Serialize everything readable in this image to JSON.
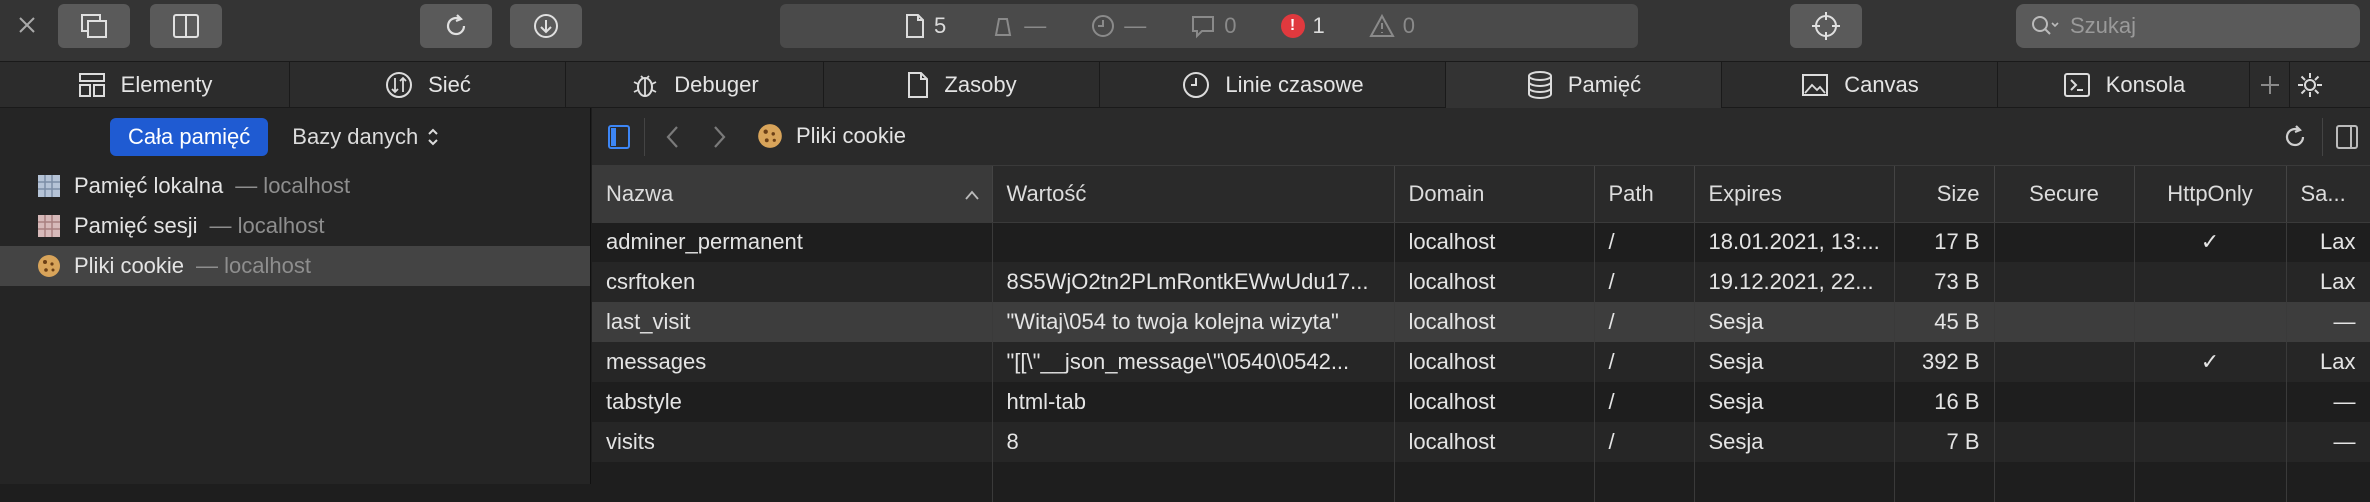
{
  "toolbar": {
    "status": {
      "resources_count": "5",
      "timeline_1": "—",
      "timeline_2": "—",
      "logs": "0",
      "errors": "1",
      "warnings": "0"
    },
    "search_placeholder": "Szukaj"
  },
  "tabs": [
    {
      "label": "Elementy",
      "icon": "elements-icon"
    },
    {
      "label": "Sieć",
      "icon": "network-icon"
    },
    {
      "label": "Debuger",
      "icon": "debugger-icon"
    },
    {
      "label": "Zasoby",
      "icon": "document-icon"
    },
    {
      "label": "Linie czasowe",
      "icon": "clock-icon"
    },
    {
      "label": "Pamięć",
      "icon": "database-icon"
    },
    {
      "label": "Canvas",
      "icon": "image-icon"
    },
    {
      "label": "Konsola",
      "icon": "console-icon"
    }
  ],
  "sidebar": {
    "filter_all": "Cała pamięć",
    "filter_db": "Bazy danych",
    "items": [
      {
        "label": "Pamięć lokalna",
        "host": "— localhost"
      },
      {
        "label": "Pamięć sesji",
        "host": "— localhost"
      },
      {
        "label": "Pliki cookie",
        "host": "— localhost"
      }
    ]
  },
  "panel": {
    "breadcrumb": "Pliki cookie"
  },
  "cookies": {
    "columns": [
      "Nazwa",
      "Wartość",
      "Domain",
      "Path",
      "Expires",
      "Size",
      "Secure",
      "HttpOnly",
      "Sa..."
    ],
    "rows": [
      {
        "name": "adminer_permanent",
        "value": "",
        "domain": "localhost",
        "path": "/",
        "expires": "18.01.2021, 13:...",
        "size": "17 B",
        "secure": "",
        "httponly": "✓",
        "samesite": "Lax"
      },
      {
        "name": "csrftoken",
        "value": "8S5WjO2tn2PLmRontkEWwUdu17...",
        "domain": "localhost",
        "path": "/",
        "expires": "19.12.2021, 22...",
        "size": "73 B",
        "secure": "",
        "httponly": "",
        "samesite": "Lax"
      },
      {
        "name": "last_visit",
        "value": "\"Witaj\\054 to twoja kolejna wizyta\"",
        "domain": "localhost",
        "path": "/",
        "expires": "Sesja",
        "size": "45 B",
        "secure": "",
        "httponly": "",
        "samesite": "—"
      },
      {
        "name": "messages",
        "value": "\"[[\\\"__json_message\\\"\\0540\\0542...",
        "domain": "localhost",
        "path": "/",
        "expires": "Sesja",
        "size": "392 B",
        "secure": "",
        "httponly": "✓",
        "samesite": "Lax"
      },
      {
        "name": "tabstyle",
        "value": "html-tab",
        "domain": "localhost",
        "path": "/",
        "expires": "Sesja",
        "size": "16 B",
        "secure": "",
        "httponly": "",
        "samesite": "—"
      },
      {
        "name": "visits",
        "value": "8",
        "domain": "localhost",
        "path": "/",
        "expires": "Sesja",
        "size": "7 B",
        "secure": "",
        "httponly": "",
        "samesite": "—"
      }
    ]
  },
  "colors": {
    "accent": "#1f5bd2",
    "error": "#e0393e",
    "selected_row": "#3d3d3d"
  }
}
